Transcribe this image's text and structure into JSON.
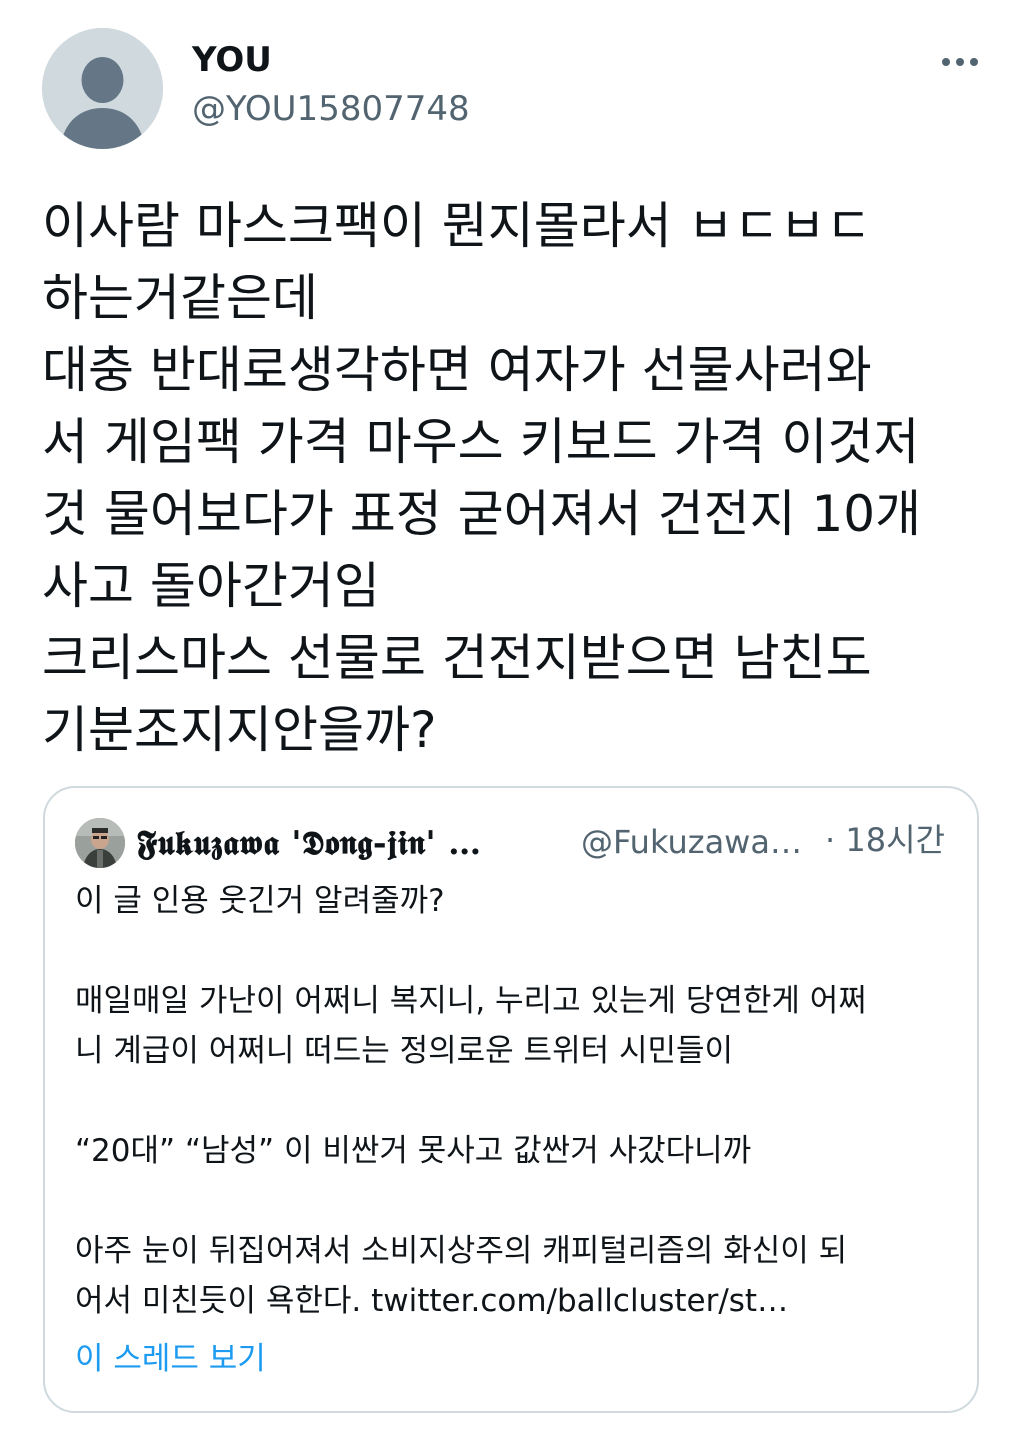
{
  "author": {
    "display_name": "YOU",
    "handle": "@YOU15807748",
    "avatar_icon": "default-profile-icon",
    "more_icon": "more-horizontal-icon"
  },
  "tweet": {
    "lines": [
      "이사람 마스크팩이 뭔지몰라서 ㅂㄷㅂㄷ",
      "하는거같은데",
      "대충 반대로생각하면 여자가 선물사러와",
      "서 게임팩 가격 마우스 키보드 가격 이것저",
      "것 물어보다가 표정 굳어져서 건전지 10개",
      "사고 돌아간거임",
      "크리스마스 선물로 건전지받으면 남친도",
      "기분조지지안을까?"
    ]
  },
  "quote": {
    "display_name": "𝕱𝖚𝖐𝖚𝖟𝖆𝖜𝖆 '𝕯𝖔𝖓𝖌-𝖏𝖎𝖓' …",
    "handle": "@Fukuzawa…",
    "time": "· 18시간",
    "avatar_icon": "user-photo-avatar",
    "lines": [
      "이 글 인용 웃긴거 알려줄까?",
      "",
      "매일매일 가난이 어쩌니 복지니, 누리고 있는게 당연한게 어쩌",
      "니 계급이 어쩌니 떠드는 정의로운 트위터 시민들이",
      "",
      "“20대” “남성” 이 비싼거 못사고 값싼거 사갔다니까",
      "",
      "아주 눈이 뒤집어져서 소비지상주의 캐피털리즘의 화신이 되",
      "어서 미친듯이 욕한다. twitter.com/ballcluster/st…"
    ],
    "show_thread": "이 스레드 보기"
  },
  "colors": {
    "text_primary": "#0f1419",
    "text_secondary": "#536471",
    "link": "#1d9bf0",
    "border": "#cfd9de"
  }
}
